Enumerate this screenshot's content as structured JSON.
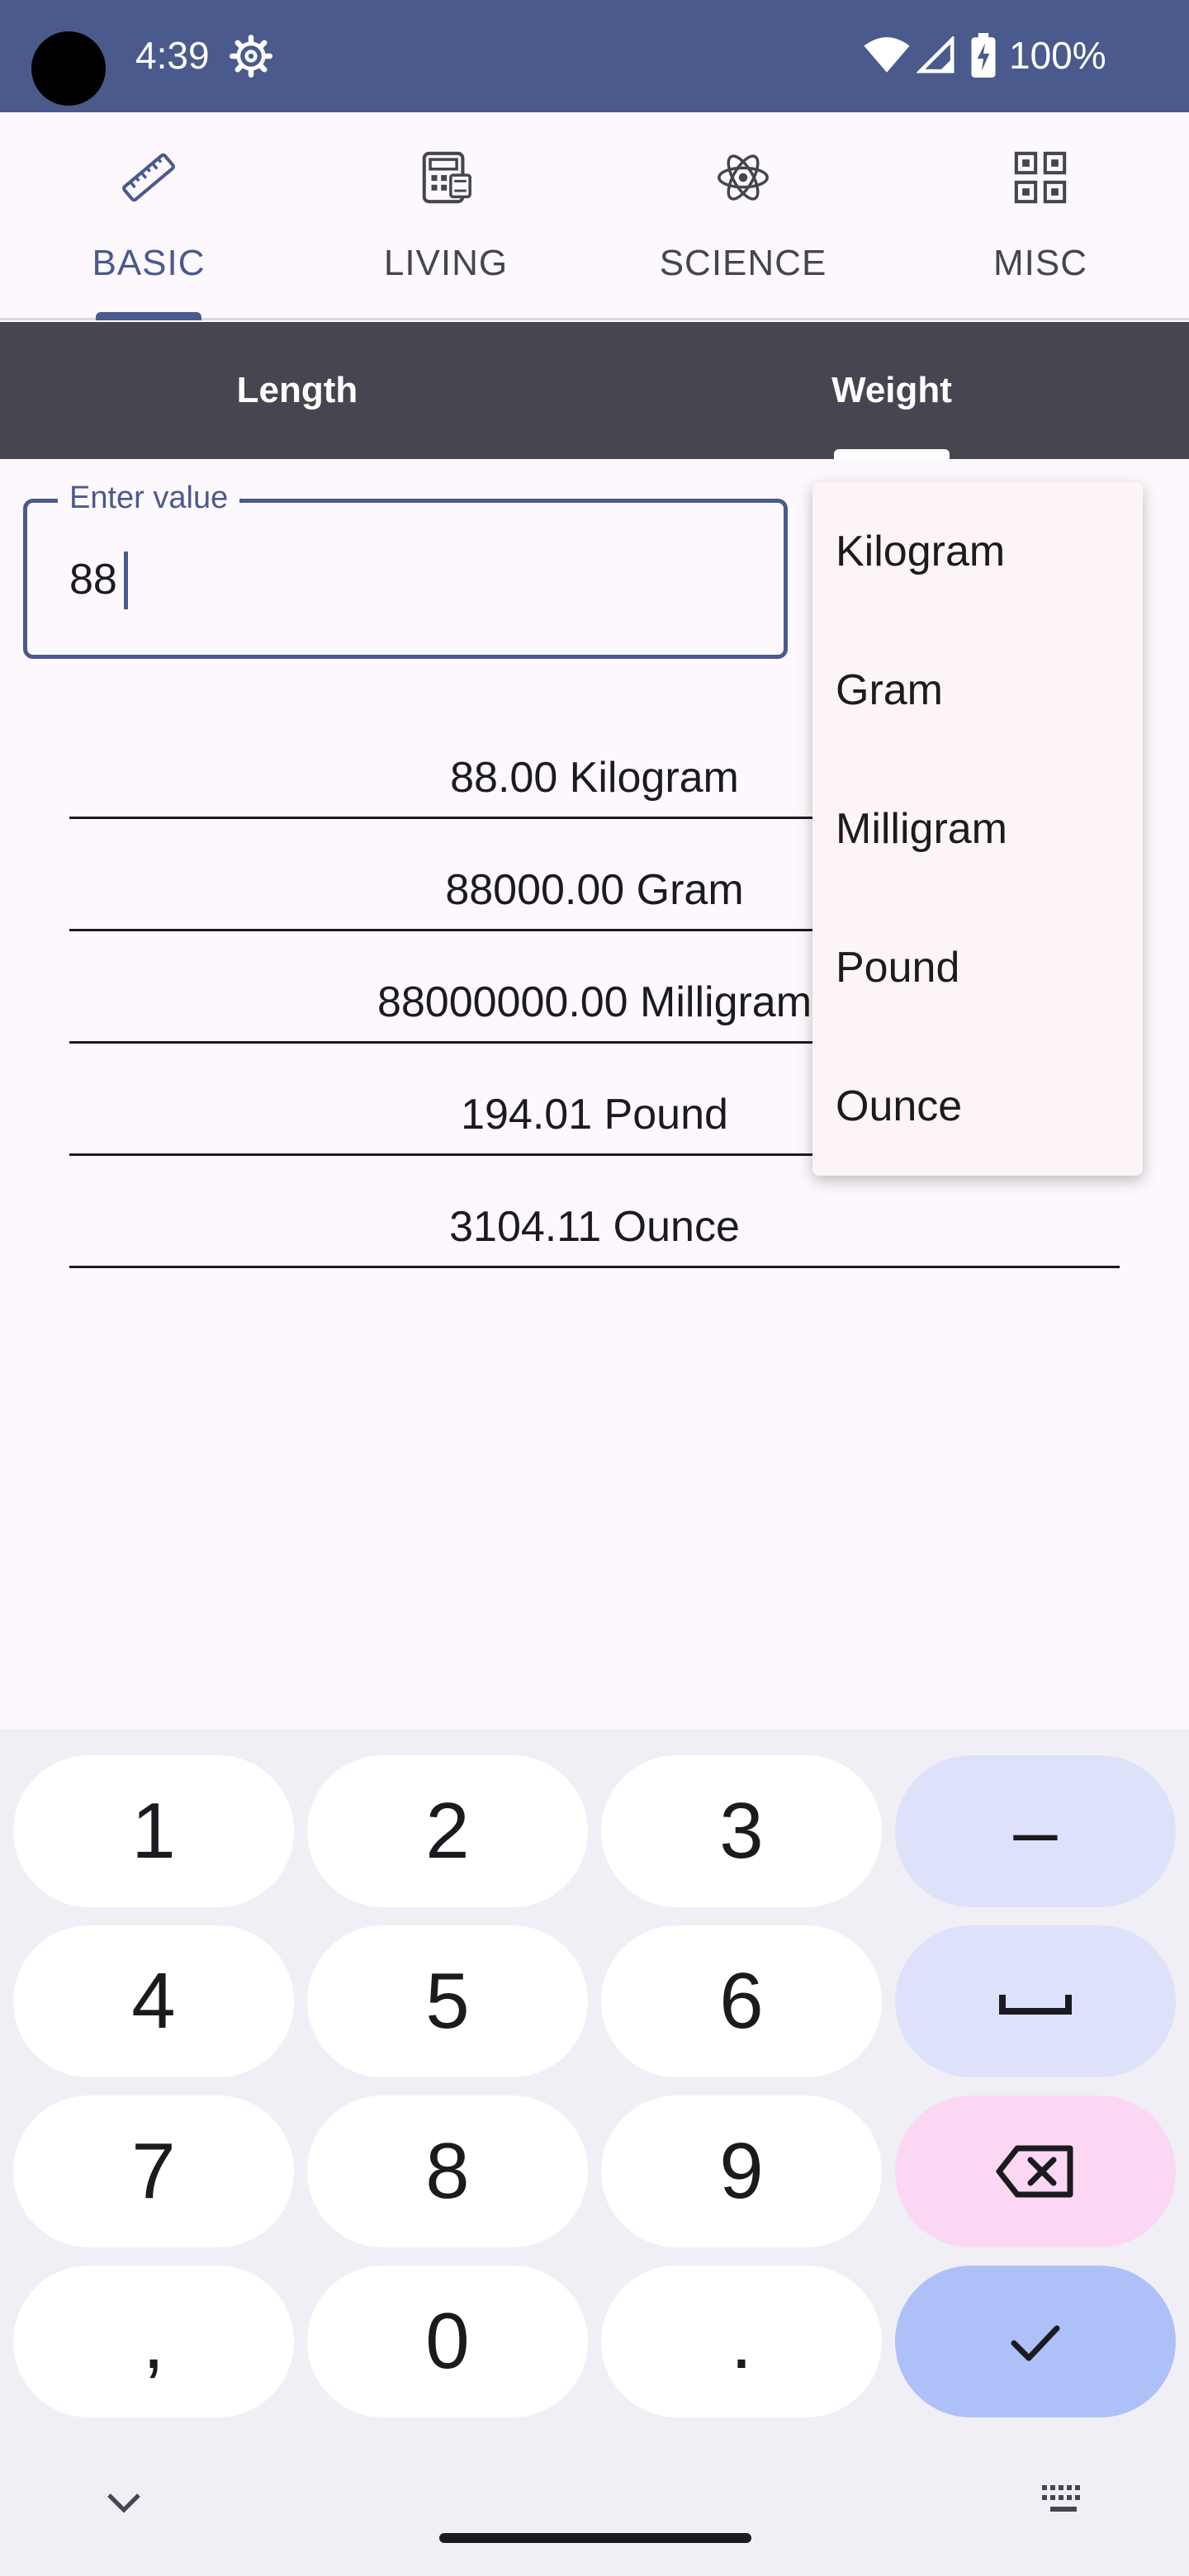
{
  "status_bar": {
    "time": "4:39",
    "battery": "100%"
  },
  "top_tabs": [
    {
      "label": "BASIC",
      "icon": "ruler-icon",
      "active": true
    },
    {
      "label": "LIVING",
      "icon": "calculator-icon",
      "active": false
    },
    {
      "label": "SCIENCE",
      "icon": "atom-icon",
      "active": false
    },
    {
      "label": "MISC",
      "icon": "qr-code-icon",
      "active": false
    }
  ],
  "sub_tabs": [
    {
      "label": "Length",
      "active": false
    },
    {
      "label": "Weight",
      "active": true
    }
  ],
  "input": {
    "label": "Enter value",
    "value": "88"
  },
  "results": [
    "88.00 Kilogram",
    "88000.00 Gram",
    "88000000.00 Milligram",
    "194.01 Pound",
    "3104.11 Ounce"
  ],
  "dropdown": {
    "options": [
      "Kilogram",
      "Gram",
      "Milligram",
      "Pound",
      "Ounce"
    ]
  },
  "keyboard": {
    "keys": [
      [
        "1",
        "2",
        "3",
        "–"
      ],
      [
        "4",
        "5",
        "6",
        "space"
      ],
      [
        "7",
        "8",
        "9",
        "backspace"
      ],
      [
        ",",
        "0",
        ".",
        "done"
      ]
    ]
  },
  "colors": {
    "primary": "#4a5a8c",
    "subtab_bg": "#45464f",
    "background": "#fdf8fd",
    "key_func": "#dde1f9",
    "key_delete": "#fbd7f4",
    "key_done": "#aec0f8"
  }
}
